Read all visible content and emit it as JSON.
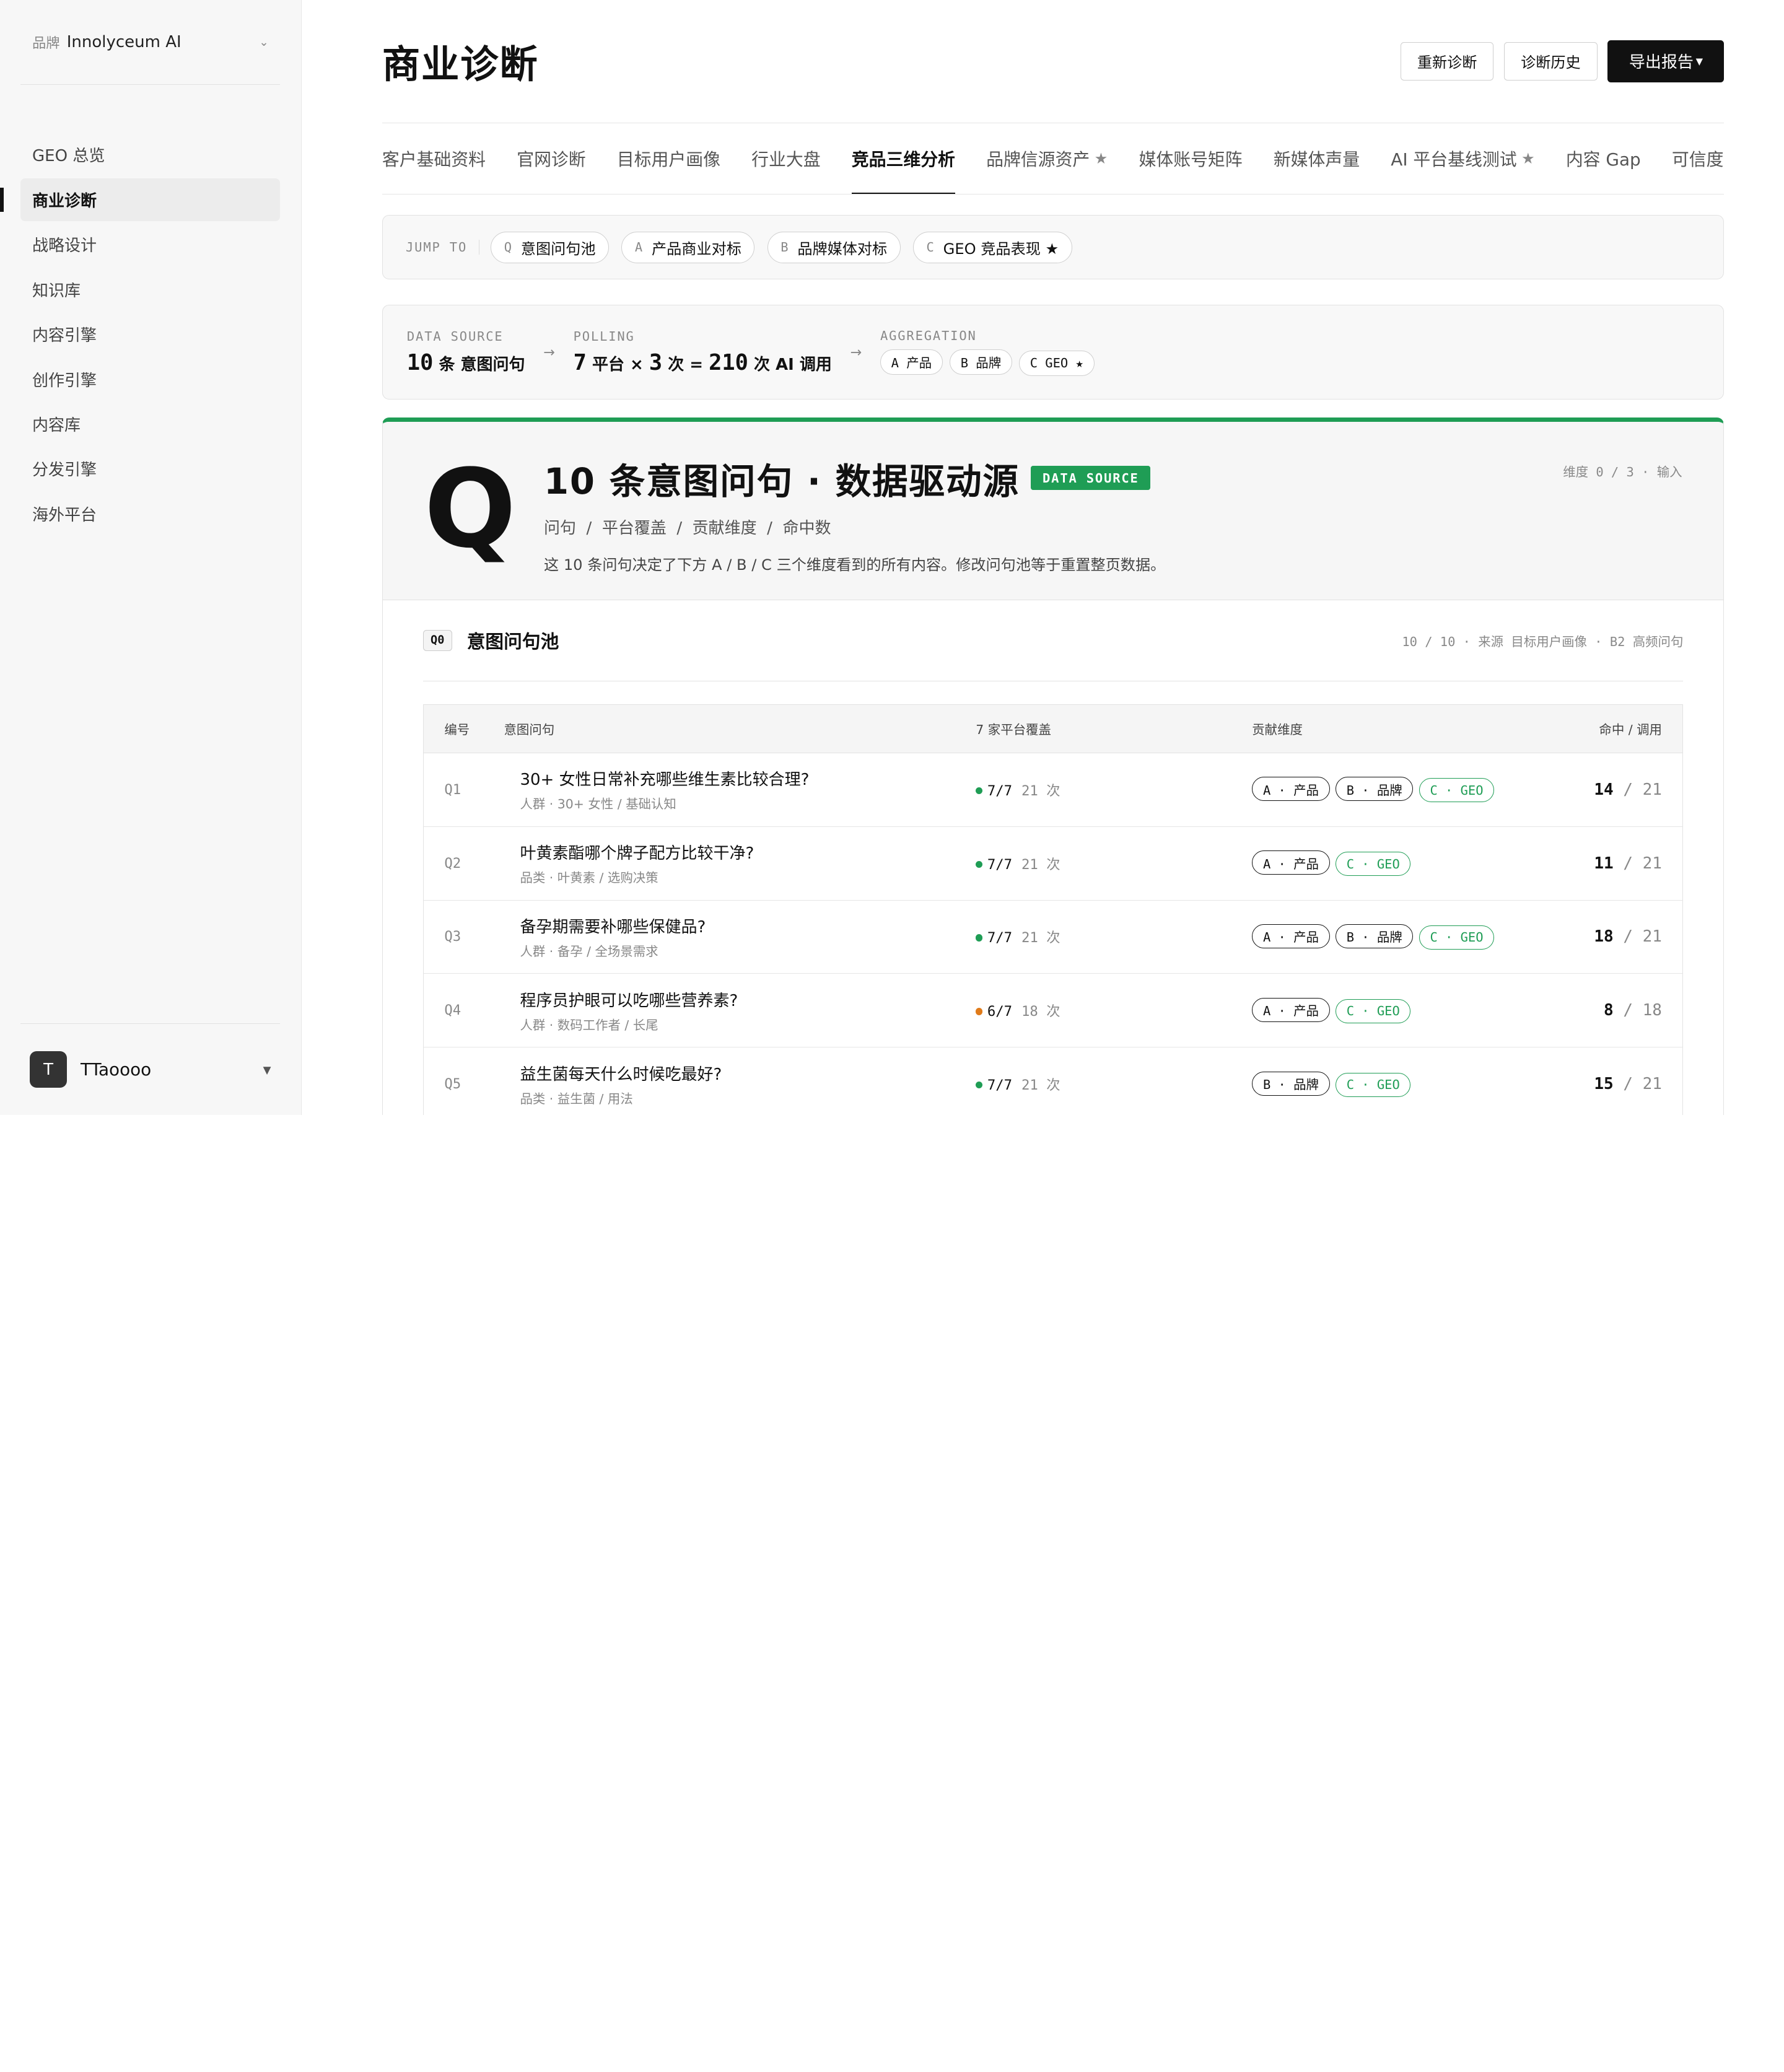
{
  "sidebar": {
    "brand_prefix": "品牌",
    "brand_name": "Innolyceum AI",
    "items": [
      "GEO 总览",
      "商业诊断",
      "战略设计",
      "知识库",
      "内容引擎",
      "创作引擎",
      "内容库",
      "分发引擎",
      "海外平台"
    ],
    "active_index": 1,
    "user_initial": "T",
    "user_name": "TTaoooo"
  },
  "header": {
    "title": "商业诊断",
    "rediagnose": "重新诊断",
    "history": "诊断历史",
    "export": "导出报告"
  },
  "tabs": [
    {
      "label": "客户基础资料",
      "star": ""
    },
    {
      "label": "官网诊断",
      "star": ""
    },
    {
      "label": "目标用户画像",
      "star": ""
    },
    {
      "label": "行业大盘",
      "star": ""
    },
    {
      "label": "竞品三维分析",
      "star": ""
    },
    {
      "label": "品牌信源资产",
      "star": "★"
    },
    {
      "label": "媒体账号矩阵",
      "star": ""
    },
    {
      "label": "新媒体声量",
      "star": ""
    },
    {
      "label": "AI 平台基线测试",
      "star": "★"
    },
    {
      "label": "内容 Gap",
      "star": ""
    },
    {
      "label": "可信度",
      "star": ""
    }
  ],
  "active_tab": 4,
  "jump": {
    "label": "JUMP TO",
    "chips": [
      {
        "key": "Q",
        "label": "意图问句池"
      },
      {
        "key": "A",
        "label": "产品商业对标"
      },
      {
        "key": "B",
        "label": "品牌媒体对标"
      },
      {
        "key": "C",
        "label": "GEO 竞品表现 ★"
      }
    ]
  },
  "pipeline": {
    "source_label": "DATA SOURCE",
    "source_num": "10",
    "source_text": "条 意图问句",
    "polling_label": "POLLING",
    "platforms": "7",
    "platforms_text": "平台 ×",
    "rounds": "3",
    "rounds_text": "次 =",
    "total": "210",
    "total_text": "次 AI 调用",
    "arrow": "→",
    "aggregation_label": "AGGREGATION",
    "agg_chips": [
      "A 产品",
      "B 品牌",
      "C GEO ★"
    ]
  },
  "card": {
    "letter": "Q",
    "title": "10 条意图问句 · 数据驱动源",
    "badge": "DATA SOURCE",
    "crumbs": "问句  /  平台覆盖  /  贡献维度  /  命中数",
    "desc": "这 10 条问句决定了下方 A / B / C 三个维度看到的所有内容。修改问句池等于重置整页数据。",
    "dim_meta": "维度 0 / 3 · 输入"
  },
  "pool": {
    "tag": "Q0",
    "title": "意图问句池",
    "meta": "10 / 10 · 来源 目标用户画像 · B2 高频问句"
  },
  "table": {
    "headers": {
      "id": "编号",
      "question": "意图问句",
      "coverage": "7 家平台覆盖",
      "dims": "贡献维度",
      "hits": "命中 / 调用"
    },
    "rows": [
      {
        "id": "Q1",
        "q": "30+ 女性日常补充哪些维生素比较合理?",
        "sub": "人群 · 30+ 女性 / 基础认知",
        "cov": "7/7",
        "times": "21 次",
        "warn": false,
        "dims": [
          "A · 产品",
          "B · 品牌",
          "C · GEO"
        ],
        "hit": "14",
        "total": "21"
      },
      {
        "id": "Q2",
        "q": "叶黄素酯哪个牌子配方比较干净?",
        "sub": "品类 · 叶黄素 / 选购决策",
        "cov": "7/7",
        "times": "21 次",
        "warn": false,
        "dims": [
          "A · 产品",
          "C · GEO"
        ],
        "hit": "11",
        "total": "21"
      },
      {
        "id": "Q3",
        "q": "备孕期需要补哪些保健品?",
        "sub": "人群 · 备孕 / 全场景需求",
        "cov": "7/7",
        "times": "21 次",
        "warn": false,
        "dims": [
          "A · 产品",
          "B · 品牌",
          "C · GEO"
        ],
        "hit": "18",
        "total": "21"
      },
      {
        "id": "Q4",
        "q": "程序员护眼可以吃哪些营养素?",
        "sub": "人群 · 数码工作者 / 长尾",
        "cov": "6/7",
        "times": "18 次",
        "warn": true,
        "dims": [
          "A · 产品",
          "C · GEO"
        ],
        "hit": "8",
        "total": "18"
      },
      {
        "id": "Q5",
        "q": "益生菌每天什么时候吃最好?",
        "sub": "品类 · 益生菌 / 用法",
        "cov": "7/7",
        "times": "21 次",
        "warn": false,
        "dims": [
          "B · 品牌",
          "C · GEO"
        ],
        "hit": "15",
        "total": "21"
      }
    ]
  },
  "colors": {
    "accent": "#1f9d55",
    "warn": "#e07b1a",
    "dark": "#111111"
  }
}
